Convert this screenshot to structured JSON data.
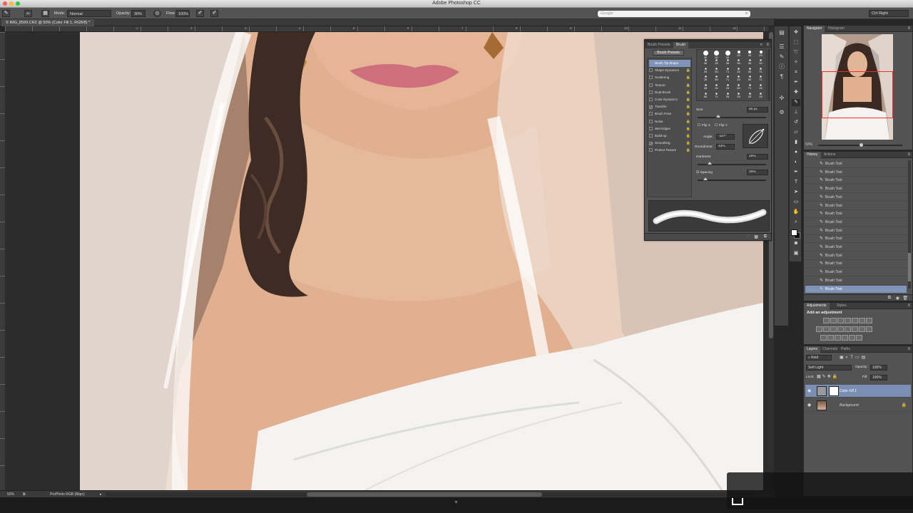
{
  "app_title": "Adobe Photoshop CC",
  "options": {
    "mode_label": "Mode:",
    "mode_value": "Normal",
    "opacity_label": "Opacity:",
    "opacity_value": "30%",
    "flow_label": "Flow:",
    "flow_value": "100%",
    "brush_size": "80"
  },
  "search": {
    "placeholder": "Google"
  },
  "workspace": "Ctrl Right",
  "document": {
    "tab_label": "© IMG_8599.CR2 @ 50% (Color Fill 1, RGB/8) *"
  },
  "ruler_ticks": [
    "1",
    "2",
    "3",
    "4",
    "5",
    "6",
    "7",
    "8",
    "9",
    "10",
    "11",
    "12"
  ],
  "status": {
    "zoom": "50%",
    "profile": "ProPhoto RGB (8bpc)"
  },
  "brush_panel": {
    "tabs": [
      "Brush Presets",
      "Brush"
    ],
    "presets_button": "Brush Presets",
    "settings": [
      {
        "label": "Brush Tip Shape",
        "checked": false,
        "selected": true
      },
      {
        "label": "Shape Dynamics",
        "checked": false
      },
      {
        "label": "Scattering",
        "checked": false
      },
      {
        "label": "Texture",
        "checked": false
      },
      {
        "label": "Dual Brush",
        "checked": false
      },
      {
        "label": "Color Dynamics",
        "checked": false
      },
      {
        "label": "Transfer",
        "checked": true
      },
      {
        "label": "Brush Pose",
        "checked": false
      },
      {
        "label": "Noise",
        "checked": false
      },
      {
        "label": "Wet Edges",
        "checked": false
      },
      {
        "label": "Build-up",
        "checked": false
      },
      {
        "label": "Smoothing",
        "checked": true
      },
      {
        "label": "Protect Texture",
        "checked": false
      }
    ],
    "tip_sizes": [
      "30",
      "30",
      "30",
      "25",
      "25",
      "25",
      "36",
      "25",
      "36",
      "36",
      "36",
      "32",
      "25",
      "50",
      "71",
      "25",
      "50",
      "71",
      "25",
      "50",
      "71",
      "25",
      "50",
      "71",
      "36",
      "32",
      "25",
      "50",
      "71",
      "25",
      "50",
      "71",
      "25"
    ],
    "size_label": "Size",
    "size_value": "80 px",
    "flip_x": "Flip X",
    "flip_y": "Flip Y",
    "angle_label": "Angle:",
    "angle_value": "-127°",
    "roundness_label": "Roundness:",
    "roundness_value": "43%",
    "hardness_label": "Hardness",
    "hardness_value": "16%",
    "spacing_label": "Spacing",
    "spacing_value": "25%"
  },
  "navigator": {
    "tabs": [
      "Navigator",
      "Histogram"
    ],
    "zoom": "50%"
  },
  "history": {
    "tabs": [
      "History",
      "Actions"
    ],
    "items": [
      "Brush Tool",
      "Brush Tool",
      "Brush Tool",
      "Brush Tool",
      "Brush Tool",
      "Brush Tool",
      "Brush Tool",
      "Brush Tool",
      "Brush Tool",
      "Brush Tool",
      "Brush Tool",
      "Brush Tool",
      "Brush Tool",
      "Brush Tool",
      "Brush Tool",
      "Brush Tool"
    ]
  },
  "adjustments": {
    "tabs": [
      "Adjustments",
      "Styles"
    ],
    "title": "Add an adjustment"
  },
  "layers": {
    "tabs": [
      "Layers",
      "Channels",
      "Paths"
    ],
    "filter": "Kind",
    "blend_mode": "Soft Light",
    "opacity_label": "Opacity:",
    "opacity_value": "100%",
    "lock_label": "Lock:",
    "fill_label": "Fill:",
    "fill_value": "100%",
    "items": [
      {
        "name": "Color Fill 1",
        "selected": true
      },
      {
        "name": "Background",
        "selected": false
      }
    ]
  },
  "colors": {
    "selection_blue": "#7f94b8",
    "panel_gray": "#535353",
    "nav_box": "#ff2a2a"
  }
}
